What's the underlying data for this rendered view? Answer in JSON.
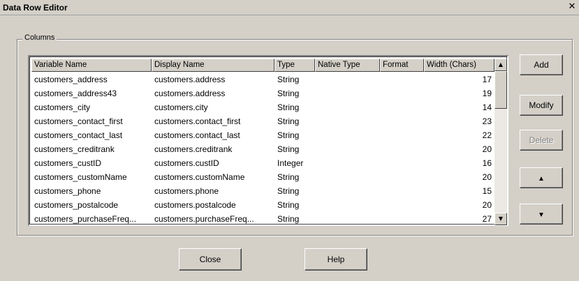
{
  "window": {
    "title": "Data Row Editor",
    "close_glyph": "✕"
  },
  "group": {
    "label": "Columns"
  },
  "table": {
    "headers": [
      "Variable Name",
      "Display Name",
      "Type",
      "Native Type",
      "Format",
      "Width (Chars)"
    ],
    "rows": [
      [
        "customers_address",
        "customers.address",
        "String",
        "",
        "",
        "17"
      ],
      [
        "customers_address43",
        "customers.address",
        "String",
        "",
        "",
        "19"
      ],
      [
        "customers_city",
        "customers.city",
        "String",
        "",
        "",
        "14"
      ],
      [
        "customers_contact_first",
        "customers.contact_first",
        "String",
        "",
        "",
        "23"
      ],
      [
        "customers_contact_last",
        "customers.contact_last",
        "String",
        "",
        "",
        "22"
      ],
      [
        "customers_creditrank",
        "customers.creditrank",
        "String",
        "",
        "",
        "20"
      ],
      [
        "customers_custID",
        "customers.custID",
        "Integer",
        "",
        "",
        "16"
      ],
      [
        "customers_customName",
        "customers.customName",
        "String",
        "",
        "",
        "20"
      ],
      [
        "customers_phone",
        "customers.phone",
        "String",
        "",
        "",
        "15"
      ],
      [
        "customers_postalcode",
        "customers.postalcode",
        "String",
        "",
        "",
        "20"
      ],
      [
        "customers_purchaseFreq...",
        "customers.purchaseFreq...",
        "String",
        "",
        "",
        "27"
      ]
    ]
  },
  "scrollbar": {
    "up_glyph": "▲",
    "down_glyph": "▼"
  },
  "side_buttons": {
    "add": "Add",
    "modify": "Modify",
    "delete": "Delete",
    "move_up_glyph": "▲",
    "move_down_glyph": "▼"
  },
  "bottom_buttons": {
    "close": "Close",
    "help": "Help"
  }
}
